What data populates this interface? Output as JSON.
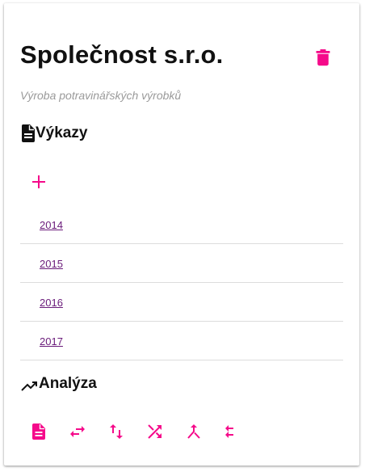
{
  "company": {
    "name": "Společnost s.r.o.",
    "description": "Výroba potravinářských výrobků"
  },
  "reports": {
    "heading": "Výkazy",
    "icon": "document-icon",
    "years": [
      "2014",
      "2015",
      "2016",
      "2017"
    ]
  },
  "analysis": {
    "heading": "Analýza",
    "icon": "trending-up-icon",
    "tools": [
      "description-icon",
      "swap-horiz-icon",
      "swap-vert-icon",
      "shuffle-icon",
      "merge-icon",
      "compare-arrows-icon"
    ]
  },
  "colors": {
    "accent": "#f50a8a",
    "link": "#6a1b7a",
    "text": "#111111",
    "muted": "#9a9a9a"
  }
}
